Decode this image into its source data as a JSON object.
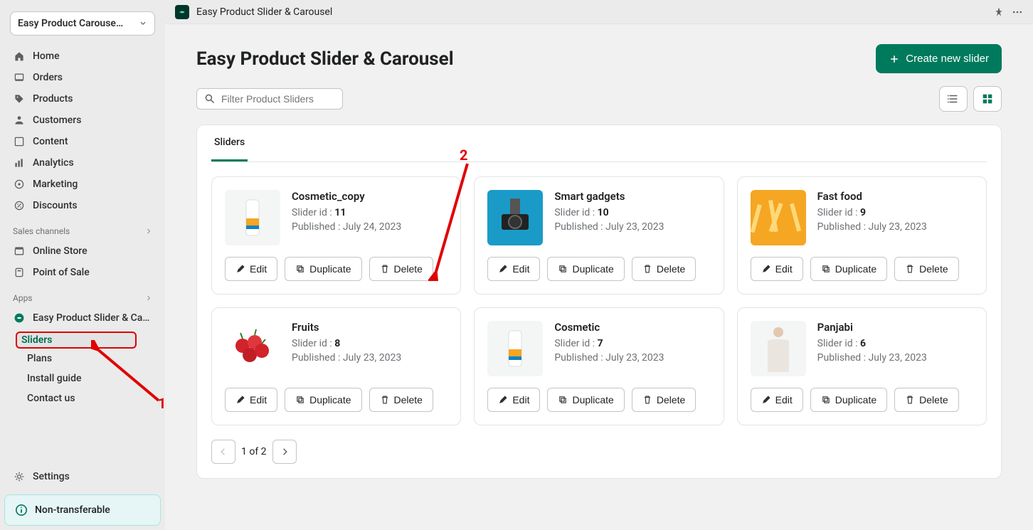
{
  "sidebar": {
    "store_name": "Easy Product Carouse…",
    "nav": [
      {
        "label": "Home"
      },
      {
        "label": "Orders"
      },
      {
        "label": "Products"
      },
      {
        "label": "Customers"
      },
      {
        "label": "Content"
      },
      {
        "label": "Analytics"
      },
      {
        "label": "Marketing"
      },
      {
        "label": "Discounts"
      }
    ],
    "sales_channels_header": "Sales channels",
    "sales_channels": [
      {
        "label": "Online Store"
      },
      {
        "label": "Point of Sale"
      }
    ],
    "apps_header": "Apps",
    "app_name": "Easy Product Slider & Ca…",
    "app_subitems": [
      {
        "label": "Sliders",
        "active": true
      },
      {
        "label": "Plans",
        "active": false
      },
      {
        "label": "Install guide",
        "active": false
      },
      {
        "label": "Contact us",
        "active": false
      }
    ],
    "settings_label": "Settings",
    "notice": "Non-transferable"
  },
  "topbar": {
    "app_title": "Easy Product Slider & Carousel"
  },
  "page": {
    "title": "Easy Product Slider & Carousel",
    "create_button": "Create new slider",
    "search_placeholder": "Filter Product Sliders",
    "tab_label": "Sliders",
    "pagination_label": "1 of 2"
  },
  "sliders": [
    {
      "title": "Cosmetic_copy",
      "id_prefix": "Slider id : ",
      "id": "11",
      "pub_prefix": "Published : ",
      "pub": "July 24, 2023"
    },
    {
      "title": "Smart gadgets",
      "id_prefix": "Slider id : ",
      "id": "10",
      "pub_prefix": "Published : ",
      "pub": "July 23, 2023"
    },
    {
      "title": "Fast food",
      "id_prefix": "Slider id : ",
      "id": "9",
      "pub_prefix": "Published : ",
      "pub": "July 23, 2023"
    },
    {
      "title": "Fruits",
      "id_prefix": "Slider id : ",
      "id": "8",
      "pub_prefix": "Published : ",
      "pub": "July 23, 2023"
    },
    {
      "title": "Cosmetic",
      "id_prefix": "Slider id : ",
      "id": "7",
      "pub_prefix": "Published : ",
      "pub": "July 23, 2023"
    },
    {
      "title": "Panjabi",
      "id_prefix": "Slider id : ",
      "id": "6",
      "pub_prefix": "Published : ",
      "pub": "July 23, 2023"
    }
  ],
  "buttons": {
    "edit": "Edit",
    "duplicate": "Duplicate",
    "delete": "Delete"
  },
  "annotations": {
    "num1": "1",
    "num2": "2"
  }
}
